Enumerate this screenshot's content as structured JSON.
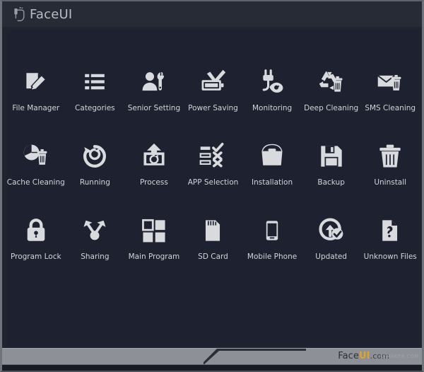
{
  "window": {
    "brand_name": "FaceUI",
    "brand_icon": "faceui-logo-icon"
  },
  "colors": {
    "window_bg": "#20242e",
    "panel_bg": "#1e2230",
    "title_bg": "#272b35",
    "frame_border": "#6f737a",
    "icon_fill": "#d8dade",
    "label_text": "#d2d4d8",
    "footer_bar": "#8d9097",
    "footer_accent": "#e0a325"
  },
  "grid": {
    "columns": 7,
    "rows": 3,
    "items": [
      {
        "label": "File Manager",
        "icon": "file-edit-icon"
      },
      {
        "label": "Categories",
        "icon": "list-icon"
      },
      {
        "label": "Senior Setting",
        "icon": "user-wrench-icon"
      },
      {
        "label": "Power Saving",
        "icon": "battery-check-icon"
      },
      {
        "label": "Monitoring",
        "icon": "plug-eye-icon"
      },
      {
        "label": "Deep Cleaning",
        "icon": "recycle-trash-icon"
      },
      {
        "label": "SMS Cleaning",
        "icon": "envelope-trash-icon"
      },
      {
        "label": "Cache Cleaning",
        "icon": "pie-trash-icon"
      },
      {
        "label": "Running",
        "icon": "refresh-circle-icon"
      },
      {
        "label": "Process",
        "icon": "box-restore-icon"
      },
      {
        "label": "APP Selection",
        "icon": "checklist-icon"
      },
      {
        "label": "Installation",
        "icon": "install-bag-icon"
      },
      {
        "label": "Backup",
        "icon": "floppy-disk-icon"
      },
      {
        "label": "Uninstall",
        "icon": "trash-icon"
      },
      {
        "label": "Program Lock",
        "icon": "padlock-icon"
      },
      {
        "label": "Sharing",
        "icon": "share-nodes-icon"
      },
      {
        "label": "Main Program",
        "icon": "grid-squares-icon"
      },
      {
        "label": "SD Card",
        "icon": "sd-card-icon"
      },
      {
        "label": "Mobile Phone",
        "icon": "smartphone-icon"
      },
      {
        "label": "Updated",
        "icon": "update-arrow-icon"
      },
      {
        "label": "Unknown Files",
        "icon": "file-question-icon"
      }
    ]
  },
  "footer": {
    "brand_prefix": "Face",
    "brand_highlight": "UI",
    "brand_suffix": ".com",
    "watermark": "UIMAKER.COM"
  }
}
